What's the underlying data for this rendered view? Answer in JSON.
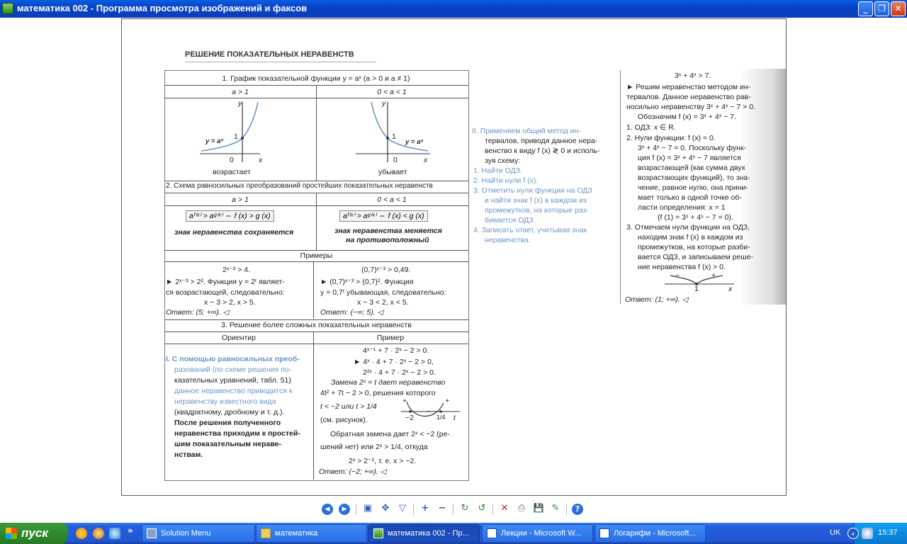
{
  "window": {
    "title": "математика 002 - Программа просмотра изображений и факсов",
    "min": "_",
    "max": "❐",
    "close": "✕"
  },
  "doc": {
    "header": "РЕШЕНИЕ ПОКАЗАТЕЛЬНЫХ НЕРАВЕНСТВ",
    "s1_title": "1. График показательной функции y = aˣ (a > 0 и a ≠ 1)",
    "col_a_gt1": "a > 1",
    "col_a_lt1": "0 < a < 1",
    "graph_y": "y",
    "graph_x": "x",
    "graph_one": "1",
    "graph_zero": "0",
    "graph_fn": "y = aˣ",
    "increases": "возрастает",
    "decreases": "убывает",
    "s2_title": "2. Схема равносильных преобразований простейших показательных неравенств",
    "f_gt": "aᶠ⁽ˣ⁾ > aᵍ⁽ˣ⁾ ⇔ f (x) > g (x)",
    "f_lt": "aᶠ⁽ˣ⁾ > aᵍ⁽ˣ⁾ ⇔ f (x) < g (x)",
    "sign_keep": "знак неравенства сохраняется",
    "sign_change1": "знак неравенства меняется",
    "sign_change2": "на противоположный",
    "examples": "Примеры",
    "ex1_l1": "2ˣ⁻³ > 4.",
    "ex1_l2": "► 2ˣ⁻³ > 2². Функция y = 2ᵗ являет-",
    "ex1_l3": "ся возрастающей, следовательно:",
    "ex1_l4": "x − 3 > 2,  x > 5.",
    "ex1_ans": "Ответ: (5; +∞). ◁",
    "ex2_l1": "(0,7)ˣ⁻³ > 0,49.",
    "ex2_l2": "► (0,7)ˣ⁻³ > (0,7)². Функция",
    "ex2_l3": "y = 0,7ᵗ убывающая, следовательно:",
    "ex2_l4": "x − 3 < 2,  x < 5.",
    "ex2_ans": "Ответ: (−∞; 5). ◁",
    "s3_title": "3. Решение более сложных показательных неравенств",
    "orient": "Ориентир",
    "example": "Пример",
    "or_l1": "I.  С помощью равносильных преоб-",
    "or_l2": "разований (по схеме решения по-",
    "or_l3": "казательных уравнений, табл. 51)",
    "or_l4": "данное неравенство приводится к",
    "or_l5": "неравенству известного вида",
    "or_l6": "(квадратному, дробному и т. д.).",
    "or_l7": "После решения полученного",
    "or_l8": "неравенства приходим к простей-",
    "or_l9": "шим показательным нераве-",
    "or_l10": "нствам.",
    "pr_l1": "4ˣ⁻¹ + 7 · 2ˣ − 2 > 0.",
    "pr_l2": "► 4ˣ · 4 + 7 · 2ˣ − 2 > 0,",
    "pr_l3": "2²ˣ · 4 + 7 · 2ˣ − 2 > 0.",
    "pr_l4": "Замена 2ˣ = t дает неравенство",
    "pr_l5": "4t² + 7t − 2 > 0, решения которого",
    "pr_l6": "t < −2 или  t > 1/4",
    "pr_l7": "(см. рисунок).",
    "pr_l8": "Обратная замена дает 2ˣ < −2 (ре-",
    "pr_l9": "шений нет) или  2ˣ > 1/4, откуда",
    "pr_l10": "2ˣ > 2⁻², т. е. x > −2.",
    "pr_ans": "Ответ: (−2; +∞). ◁",
    "mid_l1": "II.  Применяем общий метод ин-",
    "mid_l2": "тервалов, приводя данное нера-",
    "mid_l3": "венство к виду f (x) ≷ 0 и исполь-",
    "mid_l4": "зуя схему:",
    "mid_l5": "1.  Найти ОДЗ.",
    "mid_l6": "2.  Найти нули f (x).",
    "mid_l7": "3.  Отметить нули функции на ОДЗ",
    "mid_l8": "и найти знак f (x) в каждом из",
    "mid_l9": "промежутков, на которые раз-",
    "mid_l10": "бивается ОДЗ.",
    "mid_l11": "4.  Записать ответ, учитывая знак",
    "mid_l12": "неравенства.",
    "r_l1": "3ˣ + 4ˣ > 7.",
    "r_l2": "► Решим неравенство методом ин-",
    "r_l3": "тервалов. Данное неравенство рав-",
    "r_l4": "носильно неравенству 3ˣ + 4ˣ − 7 > 0.",
    "r_l5": "Обозначим f (x) = 3ˣ + 4ˣ − 7.",
    "r_l6": "1.  ОДЗ: x ∈ R.",
    "r_l7": "2.  Нули функции: f (x) = 0.",
    "r_l8": "3ˣ + 4ˣ − 7 = 0. Поскольку функ-",
    "r_l9": "ция f (x) = 3ˣ + 4ˣ − 7 является",
    "r_l10": "возрастающей (как сумма двух",
    "r_l11": "возрастающих функций), то зна-",
    "r_l12": "чение, равное нулю, она прини-",
    "r_l13": "мает только в одной точке об-",
    "r_l14": "ласти определения: x = 1",
    "r_l15": "(f (1) = 3¹ + 4¹ − 7 = 0).",
    "r_l16": "3.  Отмечаем нули функции на ОДЗ,",
    "r_l17": "находим знак f (x) в каждом из",
    "r_l18": "промежутков, на которые разби-",
    "r_l19": "вается ОДЗ, и записываем реше-",
    "r_l20": "ние неравенства f (x) > 0.",
    "r_minus": "−",
    "r_plus": "+",
    "r_one": "1",
    "r_x": "x",
    "r_ans": "Ответ: (1; +∞). ◁",
    "q_plus1": "+",
    "q_minus": "−",
    "q_plus2": "+",
    "q_m2": "−2",
    "q_frac": "1/4",
    "q_t": "t"
  },
  "toolbar": {
    "prev": "◀",
    "next": "▶",
    "best_fit": "▣",
    "actual": "✥",
    "slideshow": "▽",
    "zoom_in": "+",
    "zoom_out": "−",
    "rot_cw": "↻",
    "rot_ccw": "↺",
    "delete": "✕",
    "print": "⎙",
    "save": "💾",
    "edit": "✎",
    "help": "?"
  },
  "taskbar": {
    "start": "пуск",
    "more": "»",
    "tasks": [
      {
        "label": "Solution Menu"
      },
      {
        "label": "математика"
      },
      {
        "label": "математика 002 - Пр..."
      },
      {
        "label": "Лекции - Microsoft W..."
      },
      {
        "label": "Логарифм - Microsoft..."
      }
    ],
    "lang": "UK",
    "clock": "15:37",
    "tray_expand": "‹"
  },
  "colors": {
    "titlebar": "#0a5ee0",
    "taskbar": "#245edb",
    "start": "#2f8a2f",
    "tray": "#0b8ae0",
    "doc_blue": "#6b95c8"
  }
}
